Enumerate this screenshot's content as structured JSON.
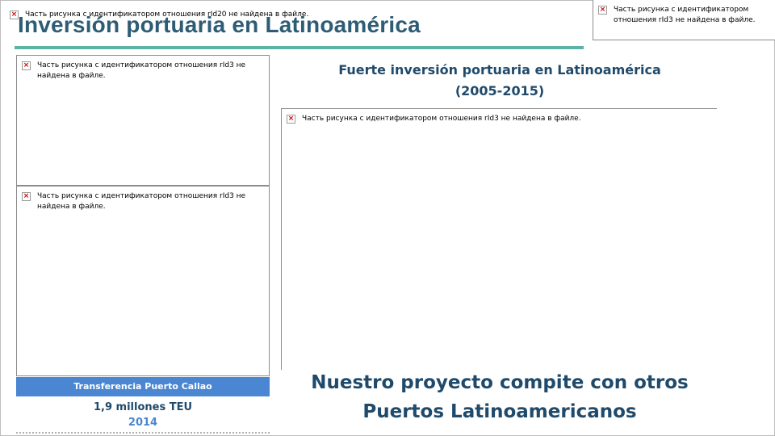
{
  "slide": {
    "title": "Inversión portuaria en Latinoamérica",
    "subtitle_line1": "Fuerte inversión portuaria en Latinoamérica",
    "subtitle_line2": "(2005-2015)",
    "bottom_message_line1": "Nuestro proyecto compite con otros",
    "bottom_message_line2": "Puertos Latinoamericanos"
  },
  "left_panel": {
    "bar_label": "Transferencia Puerto Callao",
    "teu_value": "1,9 millones TEU",
    "year": "2014"
  },
  "placeholders": {
    "top_left": "Часть рисунка с идентификатором отношения rId20 не найдена в файле.",
    "top_right": "Часть рисунка с идентификатором отношения rId3 не найдена в файле.",
    "left_1": "Часть рисунка с идентификатором отношения rId3 не найдена в файле.",
    "left_2": "Часть рисунка с идентификатором отношения rId3 не найдена в файле.",
    "center": "Часть рисунка с идентификатором отношения rId3 не найдена в файле."
  },
  "icons": {
    "missing_image": "broken-image-icon"
  },
  "colors": {
    "title": "#2e5c75",
    "accent_line": "#5bb3a6",
    "heading": "#1f4a6b",
    "callao_bar": "#4a86d1"
  }
}
